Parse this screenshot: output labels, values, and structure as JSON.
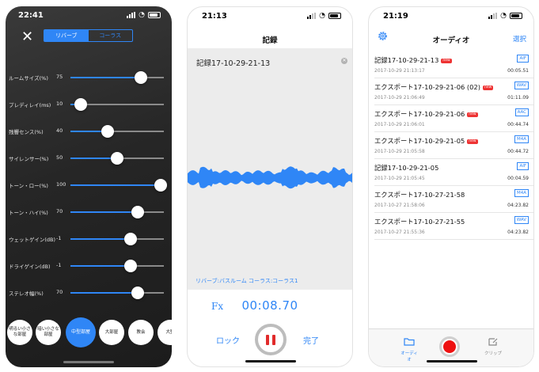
{
  "screen1": {
    "time": "22:41",
    "tabs": [
      {
        "label": "リバーブ",
        "active": true
      },
      {
        "label": "コーラス",
        "active": false
      }
    ],
    "sliders": [
      {
        "label": "ルームサイズ(%)",
        "value": "75",
        "level": 0.75
      },
      {
        "label": "プレディレイ(ms)",
        "value": "10",
        "level": 0.11
      },
      {
        "label": "残響センス(%)",
        "value": "40",
        "level": 0.4
      },
      {
        "label": "サイレンサー(%)",
        "value": "50",
        "level": 0.5
      },
      {
        "label": "トーン・ロー(%)",
        "value": "100",
        "level": 0.97
      },
      {
        "label": "トーン・ハイ(%)",
        "value": "70",
        "level": 0.72
      },
      {
        "label": "ウェットゲイン(dB)",
        "value": "-1",
        "level": 0.64
      },
      {
        "label": "ドライゲイン(dB)",
        "value": "-1",
        "level": 0.64
      },
      {
        "label": "ステレオ幅(%)",
        "value": "70",
        "level": 0.72
      }
    ],
    "presets": [
      {
        "label": "明るい小さな部屋",
        "active": false
      },
      {
        "label": "暗い小さな部屋",
        "active": false
      },
      {
        "label": "中型部屋",
        "active": true
      },
      {
        "label": "大部屋",
        "active": false
      },
      {
        "label": "教会",
        "active": false
      },
      {
        "label": "大聖",
        "active": false
      }
    ],
    "accent": "#2f86f6"
  },
  "screen2": {
    "time": "21:13",
    "title": "記録",
    "filename": "記録17-10-29-21-13",
    "effect": "リバーブ:バスルーム  コーラス:コーラス1",
    "fx_label": "Fx",
    "elapsed": "00:08.70",
    "lock_label": "ロック",
    "done_label": "完了",
    "pause_color": "#e12b2b"
  },
  "screen3": {
    "time": "21:19",
    "title": "オーディオ",
    "select_label": "選択",
    "new_badge": "new",
    "recordings": [
      {
        "name": "記録17-10-29-21-13",
        "new": true,
        "date": "2017-10-29 21:13:17",
        "format": "AIF",
        "duration": "00:05.51"
      },
      {
        "name": "エクスポート17-10-29-21-06 (02)",
        "new": true,
        "date": "2017-10-29 21:06:49",
        "format": "WAV",
        "duration": "01:11.09"
      },
      {
        "name": "エクスポート17-10-29-21-06",
        "new": true,
        "date": "2017-10-29 21:06:01",
        "format": "AAC",
        "duration": "00:44.74"
      },
      {
        "name": "エクスポート17-10-29-21-05",
        "new": true,
        "date": "2017-10-29 21:05:58",
        "format": "M4A",
        "duration": "00:44.72"
      },
      {
        "name": "記録17-10-29-21-05",
        "new": false,
        "date": "2017-10-29 21:05:45",
        "format": "AIF",
        "duration": "00:04.59"
      },
      {
        "name": "エクスポート17-10-27-21-58",
        "new": false,
        "date": "2017-10-27 21:58:06",
        "format": "M4A",
        "duration": "04:23.82"
      },
      {
        "name": "エクスポート17-10-27-21-55",
        "new": false,
        "date": "2017-10-27 21:55:36",
        "format": "WAV",
        "duration": "04:23.82"
      }
    ],
    "tabbar": {
      "audio_label": "オーディオ",
      "clip_label": "クリップ"
    },
    "record_color": "#ee1111"
  }
}
